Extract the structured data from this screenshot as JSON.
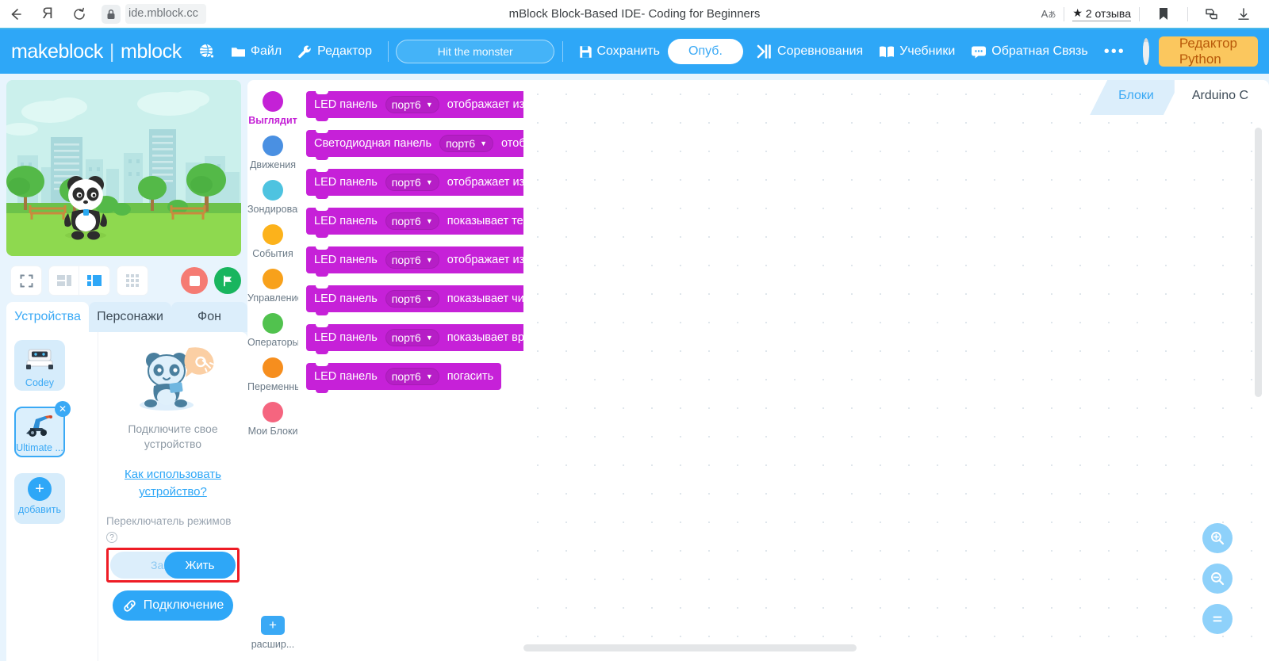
{
  "browser": {
    "back_icon": "back-arrow-icon",
    "brand_icon": "yandex-logo-icon",
    "reload_icon": "reload-icon",
    "lock_icon": "lock-icon",
    "url": "ide.mblock.cc",
    "page_title": "mBlock Block-Based IDE- Coding for Beginners",
    "translate_icon": "translate-icon",
    "reviews_label": "2 отзыва",
    "bookmark_icon": "bookmark-icon",
    "collections_icon": "collections-icon",
    "download_icon": "download-icon"
  },
  "header": {
    "logo_primary": "makeblock",
    "logo_divider": "|",
    "logo_secondary": "mblock",
    "globe_label": "",
    "file_label": "Файл",
    "edit_label": "Редактор",
    "project_name": "Hit the monster",
    "save_label": "Сохранить",
    "publish_label": "Опуб.",
    "competitions_label": "Соревнования",
    "tutorials_label": "Учебники",
    "feedback_label": "Обратная Связь",
    "more_label": "•••",
    "python_editor_label": "Редактор Python",
    "accent_blue": "#2ea7f7",
    "python_btn_bg": "#fbc75e",
    "python_btn_fg": "#b8590a"
  },
  "stage": {
    "sprite_name": "panda",
    "fullscreen_icon": "fullscreen-icon",
    "layout_small_icon": "layout-small-stage-icon",
    "layout_large_icon": "layout-large-stage-icon",
    "grid_icon": "grid-icon",
    "stop_icon": "stop-icon",
    "start_icon": "green-flag-icon"
  },
  "panel_tabs": [
    {
      "label": "Устройства",
      "active": true
    },
    {
      "label": "Персонажи",
      "active": false
    },
    {
      "label": "Фон",
      "active": false
    }
  ],
  "devices": {
    "items": [
      {
        "label": "Codey",
        "selected": false,
        "icon": "codey-robot-icon"
      },
      {
        "label": "Ultimate ...",
        "selected": true,
        "icon": "ultimate-robot-icon",
        "close_icon": "close-icon"
      }
    ],
    "add_label": "добавить",
    "add_icon": "plus-icon",
    "connect_hint": "Подключите свое устройство",
    "howto_link": "Как использовать устройство?",
    "mode_switch_label": "Переключатель режимов",
    "help_icon": "question-mark-icon",
    "mode_upload_label": "Загрузить",
    "mode_live_label": "Жить",
    "connect_button_label": "Подключение",
    "connect_icon": "link-icon",
    "highlight_color": "#ee1c25"
  },
  "categories": [
    {
      "label": "Выглядит",
      "color": "#c421d6",
      "active": true
    },
    {
      "label": "Движения",
      "color": "#4a90e2",
      "active": false
    },
    {
      "label": "Зондирование",
      "color": "#4ec3e0",
      "active": false
    },
    {
      "label": "События",
      "color": "#fcb21b",
      "active": false
    },
    {
      "label": "Управление",
      "color": "#f8a11b",
      "active": false
    },
    {
      "label": "Операторы",
      "color": "#51c24e",
      "active": false
    },
    {
      "label": "Переменные",
      "color": "#f68e1e",
      "active": false
    },
    {
      "label": "Мои Блоки",
      "color": "#f5657f",
      "active": false
    }
  ],
  "extensions": {
    "label": "расшир...",
    "icon": "add-extension-icon"
  },
  "blocks": [
    {
      "prefix": "LED панель",
      "port": "порт6",
      "suffix": "отображает изо"
    },
    {
      "prefix": "Светодиодная панель",
      "port": "порт6",
      "suffix": "отоб"
    },
    {
      "prefix": "LED панель",
      "port": "порт6",
      "suffix": "отображает изо"
    },
    {
      "prefix": "LED панель",
      "port": "порт6",
      "suffix": "показывает тек"
    },
    {
      "prefix": "LED панель",
      "port": "порт6",
      "suffix": "отображает изо"
    },
    {
      "prefix": "LED панель",
      "port": "порт6",
      "suffix": "показывает чис"
    },
    {
      "prefix": "LED панель",
      "port": "порт6",
      "suffix": "показывает вре"
    },
    {
      "prefix": "LED панель",
      "port": "порт6",
      "suffix": "погасить"
    }
  ],
  "block_style": {
    "fill": "#c621d8",
    "dropdown_fill": "#b61ec6",
    "caret": "▼"
  },
  "code_tabs": [
    {
      "label": "Блоки",
      "active": true
    },
    {
      "label": "Arduino C",
      "active": false
    }
  ],
  "canvas_controls": {
    "zoom_in_icon": "zoom-in-icon",
    "zoom_out_icon": "zoom-out-icon",
    "zoom_reset_icon": "zoom-reset-icon",
    "vertical_scrollbar": "vertical-scrollbar",
    "horizontal_scrollbar": "horizontal-scrollbar"
  }
}
